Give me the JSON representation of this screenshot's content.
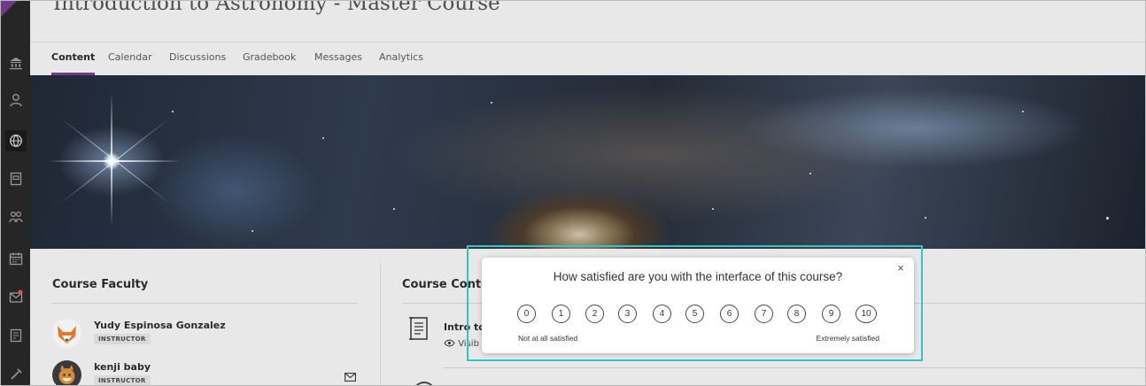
{
  "course": {
    "title": "Introduction to Astronomy - Master Course"
  },
  "tabs": [
    {
      "label": "Content",
      "active": true
    },
    {
      "label": "Calendar"
    },
    {
      "label": "Discussions"
    },
    {
      "label": "Gradebook"
    },
    {
      "label": "Messages"
    },
    {
      "label": "Analytics"
    }
  ],
  "rail": {
    "icons": [
      "institution-icon",
      "profile-icon",
      "globe-icon",
      "courses-icon",
      "groups-icon",
      "calendar-icon",
      "messages-icon",
      "grades-icon",
      "tools-icon"
    ]
  },
  "faculty": {
    "heading": "Course Faculty",
    "people": [
      {
        "name": "Yudy Espinosa Gonzalez",
        "role": "INSTRUCTOR"
      },
      {
        "name": "kenji baby",
        "role": "INSTRUCTOR"
      }
    ]
  },
  "course_content": {
    "heading": "Course Content",
    "item": {
      "title": "Intro to",
      "visibility": "Visib"
    }
  },
  "survey": {
    "question": "How satisfied are you with the interface of this course?",
    "close_label": "×",
    "options": [
      "0",
      "1",
      "2",
      "3",
      "4",
      "5",
      "6",
      "7",
      "8",
      "9",
      "10"
    ],
    "low_label": "Not at all satisfied",
    "high_label": "Extremely satisfied"
  },
  "colors": {
    "accent": "#6d3a8c",
    "highlight": "#36c2c8"
  }
}
